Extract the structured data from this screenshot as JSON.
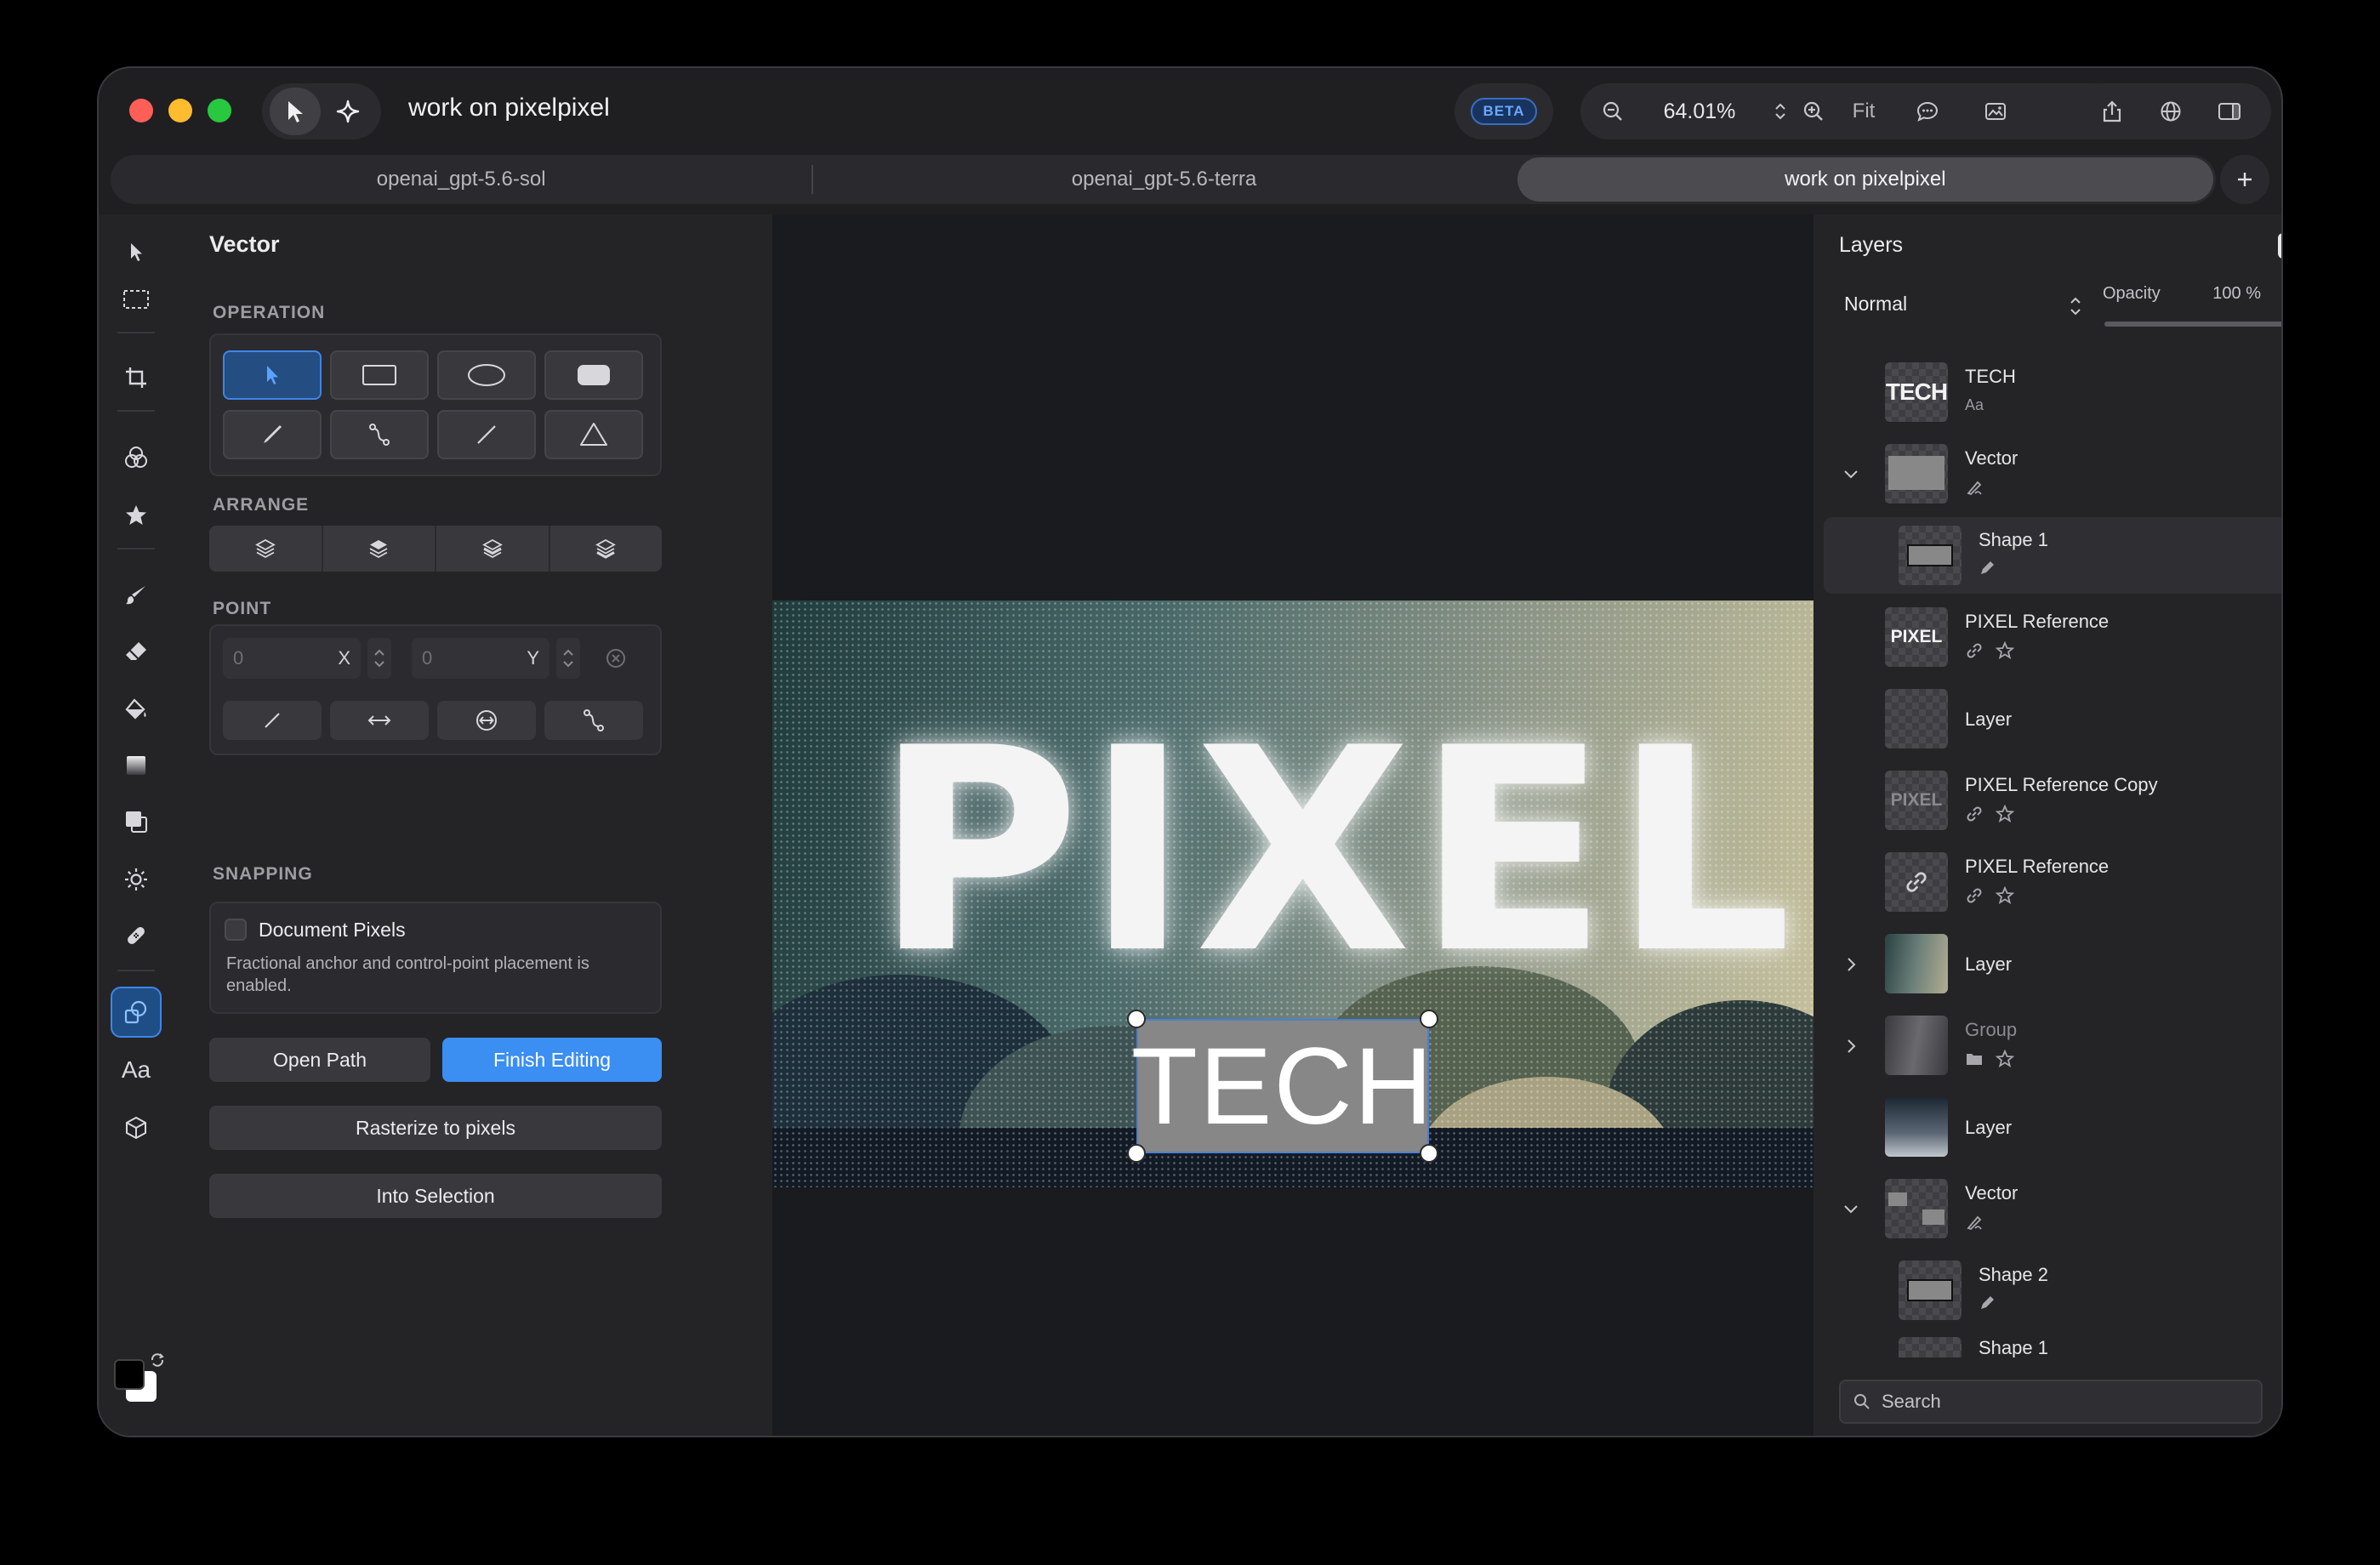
{
  "window": {
    "title": "work on pixelpixel",
    "beta": "BETA",
    "zoom": "64.01%",
    "fit": "Fit"
  },
  "tabs": [
    {
      "label": "openai_gpt-5.6-sol"
    },
    {
      "label": "openai_gpt-5.6-terra"
    },
    {
      "label": "work on pixelpixel"
    }
  ],
  "options": {
    "title": "Vector",
    "operation_label": "OPERATION",
    "arrange_label": "ARRANGE",
    "point_label": "POINT",
    "snapping_label": "SNAPPING",
    "point_x_value": "0",
    "point_x_label": "X",
    "point_y_value": "0",
    "point_y_label": "Y",
    "snap_title": "Document Pixels",
    "snap_desc": "Fractional anchor and control-point placement is enabled.",
    "open_path": "Open Path",
    "finish_editing": "Finish Editing",
    "rasterize": "Rasterize to pixels",
    "into_selection": "Into Selection"
  },
  "canvas": {
    "pixel_text": "PIXEL",
    "tech_text": "TECH"
  },
  "layers": {
    "title": "Layers",
    "blend_mode": "Normal",
    "opacity_label": "Opacity",
    "opacity_value": "100 %",
    "opacity_fraction": 1.0,
    "search_placeholder": "Search",
    "items": [
      {
        "name": "TECH",
        "sub": "Aa",
        "thumb_text": "TECH"
      },
      {
        "name": "Vector"
      },
      {
        "name": "Shape 1"
      },
      {
        "name": "PIXEL Reference",
        "thumb_text": "PIXEL"
      },
      {
        "name": "Layer"
      },
      {
        "name": "PIXEL Reference Copy",
        "thumb_text": "PIXEL"
      },
      {
        "name": "PIXEL Reference"
      },
      {
        "name": "Layer"
      },
      {
        "name": "Group"
      },
      {
        "name": "Layer"
      },
      {
        "name": "Vector"
      },
      {
        "name": "Shape 2"
      },
      {
        "name": "Shape 1"
      }
    ]
  },
  "colors": {
    "accent": "#3b8ef2",
    "close": "#ff5f57",
    "minimize": "#febc2e",
    "maximize": "#28c840"
  }
}
